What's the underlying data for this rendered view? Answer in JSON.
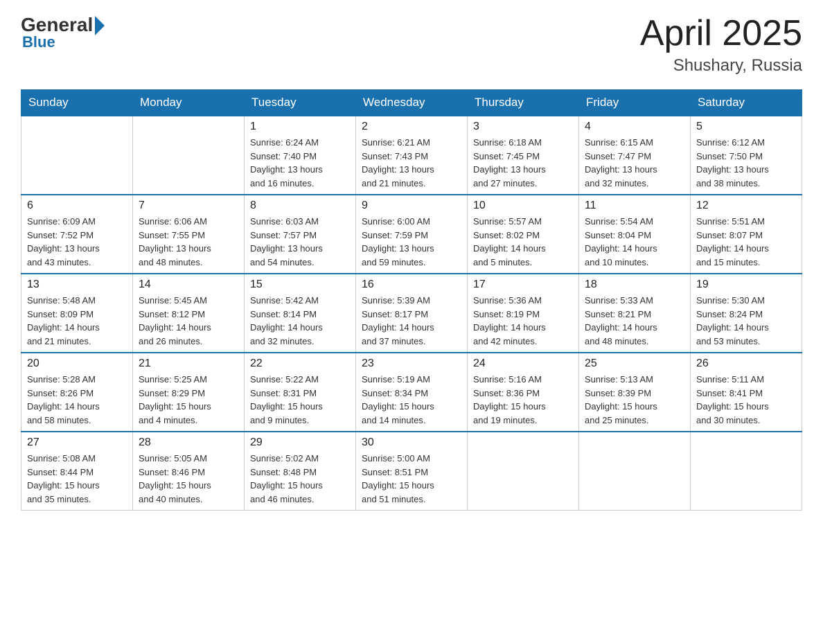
{
  "header": {
    "logo": {
      "general": "General",
      "blue": "Blue",
      "subtitle": "Blue"
    },
    "title": "April 2025",
    "location": "Shushary, Russia"
  },
  "days_of_week": [
    "Sunday",
    "Monday",
    "Tuesday",
    "Wednesday",
    "Thursday",
    "Friday",
    "Saturday"
  ],
  "weeks": [
    [
      {
        "day": "",
        "info": ""
      },
      {
        "day": "",
        "info": ""
      },
      {
        "day": "1",
        "info": "Sunrise: 6:24 AM\nSunset: 7:40 PM\nDaylight: 13 hours\nand 16 minutes."
      },
      {
        "day": "2",
        "info": "Sunrise: 6:21 AM\nSunset: 7:43 PM\nDaylight: 13 hours\nand 21 minutes."
      },
      {
        "day": "3",
        "info": "Sunrise: 6:18 AM\nSunset: 7:45 PM\nDaylight: 13 hours\nand 27 minutes."
      },
      {
        "day": "4",
        "info": "Sunrise: 6:15 AM\nSunset: 7:47 PM\nDaylight: 13 hours\nand 32 minutes."
      },
      {
        "day": "5",
        "info": "Sunrise: 6:12 AM\nSunset: 7:50 PM\nDaylight: 13 hours\nand 38 minutes."
      }
    ],
    [
      {
        "day": "6",
        "info": "Sunrise: 6:09 AM\nSunset: 7:52 PM\nDaylight: 13 hours\nand 43 minutes."
      },
      {
        "day": "7",
        "info": "Sunrise: 6:06 AM\nSunset: 7:55 PM\nDaylight: 13 hours\nand 48 minutes."
      },
      {
        "day": "8",
        "info": "Sunrise: 6:03 AM\nSunset: 7:57 PM\nDaylight: 13 hours\nand 54 minutes."
      },
      {
        "day": "9",
        "info": "Sunrise: 6:00 AM\nSunset: 7:59 PM\nDaylight: 13 hours\nand 59 minutes."
      },
      {
        "day": "10",
        "info": "Sunrise: 5:57 AM\nSunset: 8:02 PM\nDaylight: 14 hours\nand 5 minutes."
      },
      {
        "day": "11",
        "info": "Sunrise: 5:54 AM\nSunset: 8:04 PM\nDaylight: 14 hours\nand 10 minutes."
      },
      {
        "day": "12",
        "info": "Sunrise: 5:51 AM\nSunset: 8:07 PM\nDaylight: 14 hours\nand 15 minutes."
      }
    ],
    [
      {
        "day": "13",
        "info": "Sunrise: 5:48 AM\nSunset: 8:09 PM\nDaylight: 14 hours\nand 21 minutes."
      },
      {
        "day": "14",
        "info": "Sunrise: 5:45 AM\nSunset: 8:12 PM\nDaylight: 14 hours\nand 26 minutes."
      },
      {
        "day": "15",
        "info": "Sunrise: 5:42 AM\nSunset: 8:14 PM\nDaylight: 14 hours\nand 32 minutes."
      },
      {
        "day": "16",
        "info": "Sunrise: 5:39 AM\nSunset: 8:17 PM\nDaylight: 14 hours\nand 37 minutes."
      },
      {
        "day": "17",
        "info": "Sunrise: 5:36 AM\nSunset: 8:19 PM\nDaylight: 14 hours\nand 42 minutes."
      },
      {
        "day": "18",
        "info": "Sunrise: 5:33 AM\nSunset: 8:21 PM\nDaylight: 14 hours\nand 48 minutes."
      },
      {
        "day": "19",
        "info": "Sunrise: 5:30 AM\nSunset: 8:24 PM\nDaylight: 14 hours\nand 53 minutes."
      }
    ],
    [
      {
        "day": "20",
        "info": "Sunrise: 5:28 AM\nSunset: 8:26 PM\nDaylight: 14 hours\nand 58 minutes."
      },
      {
        "day": "21",
        "info": "Sunrise: 5:25 AM\nSunset: 8:29 PM\nDaylight: 15 hours\nand 4 minutes."
      },
      {
        "day": "22",
        "info": "Sunrise: 5:22 AM\nSunset: 8:31 PM\nDaylight: 15 hours\nand 9 minutes."
      },
      {
        "day": "23",
        "info": "Sunrise: 5:19 AM\nSunset: 8:34 PM\nDaylight: 15 hours\nand 14 minutes."
      },
      {
        "day": "24",
        "info": "Sunrise: 5:16 AM\nSunset: 8:36 PM\nDaylight: 15 hours\nand 19 minutes."
      },
      {
        "day": "25",
        "info": "Sunrise: 5:13 AM\nSunset: 8:39 PM\nDaylight: 15 hours\nand 25 minutes."
      },
      {
        "day": "26",
        "info": "Sunrise: 5:11 AM\nSunset: 8:41 PM\nDaylight: 15 hours\nand 30 minutes."
      }
    ],
    [
      {
        "day": "27",
        "info": "Sunrise: 5:08 AM\nSunset: 8:44 PM\nDaylight: 15 hours\nand 35 minutes."
      },
      {
        "day": "28",
        "info": "Sunrise: 5:05 AM\nSunset: 8:46 PM\nDaylight: 15 hours\nand 40 minutes."
      },
      {
        "day": "29",
        "info": "Sunrise: 5:02 AM\nSunset: 8:48 PM\nDaylight: 15 hours\nand 46 minutes."
      },
      {
        "day": "30",
        "info": "Sunrise: 5:00 AM\nSunset: 8:51 PM\nDaylight: 15 hours\nand 51 minutes."
      },
      {
        "day": "",
        "info": ""
      },
      {
        "day": "",
        "info": ""
      },
      {
        "day": "",
        "info": ""
      }
    ]
  ]
}
